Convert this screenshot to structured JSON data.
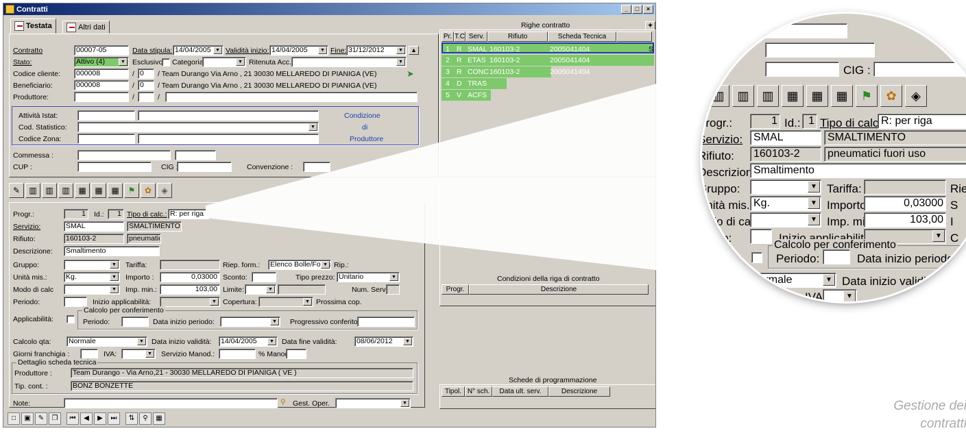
{
  "window": {
    "title": "Contratti",
    "min": "_",
    "max": "□",
    "close": "×"
  },
  "tabs": {
    "testata": "Testata",
    "altri": "Altri dati"
  },
  "header": {
    "contratto_lbl": "Contratto",
    "contratto": "00007-05",
    "data_stipula_lbl": "Data stipula:",
    "data_stipula": "14/04/2005",
    "validita_lbl": "Validità inizio:",
    "validita": "14/04/2005",
    "fine_lbl": "Fine:",
    "fine": "31/12/2012",
    "stato_lbl": "Stato:",
    "stato": "Attivo (4)",
    "esclusivo_lbl": "Esclusivo:",
    "categoria_lbl": "Categoria",
    "ritenuta_lbl": "Ritenuta Acc.:",
    "codcli_lbl": "Codice cliente:",
    "codcli": "000008",
    "codcli_n": "0",
    "codcli_desc": "/ Team Durango  Via Arno , 21  30030  MELLAREDO DI PIANIGA  (VE)",
    "benef_lbl": "Beneficiario:",
    "benef": "000008",
    "benef_n": "0",
    "benef_desc": "/ Team Durango  Via Arno , 21  30030  MELLAREDO DI PIANIGA  (VE)",
    "prod_lbl": "Produttore:",
    "slash1": "/",
    "slash2": "/",
    "istat_lbl": "Attività Istat:",
    "codstat_lbl": "Cod. Statistico:",
    "codzona_lbl": "Codice Zona:",
    "cond1": "Condizione",
    "cond2": "di",
    "cond3": "Produttore",
    "commessa_lbl": "Commessa :",
    "cup_lbl": "CUP :",
    "cig_lbl": "CIG :",
    "conv_lbl": "Convenzione :"
  },
  "righe": {
    "title": "Righe contratto",
    "cols": [
      "Pr.",
      "T.C.",
      "Serv.",
      "Rifiuto",
      "Scheda Tecnica"
    ],
    "rows": [
      {
        "pr": "1",
        "tc": "R",
        "serv": "SMAL",
        "rif": "160103-2",
        "sch": "2005041404",
        "x": "S"
      },
      {
        "pr": "2",
        "tc": "R",
        "serv": "ETAS",
        "rif": "160103-2",
        "sch": "2005041404",
        "x": ""
      },
      {
        "pr": "3",
        "tc": "R",
        "serv": "CONC",
        "rif": "160103-2",
        "sch": "2005041404",
        "x": ""
      },
      {
        "pr": "4",
        "tc": "D",
        "serv": "TRAS",
        "rif": "",
        "sch": "",
        "x": ""
      },
      {
        "pr": "5",
        "tc": "V",
        "serv": "ACFS",
        "rif": "",
        "sch": "",
        "x": ""
      }
    ]
  },
  "condizioni": {
    "title": "Condizioni della riga di contratto",
    "cols": [
      "Progr.",
      "Descrizione"
    ]
  },
  "schede": {
    "title": "Schede di programmazione",
    "cols": [
      "Tipol.",
      "N° sch.",
      "Data ult. serv.",
      "Descrizione"
    ]
  },
  "detail": {
    "progr_lbl": "Progr.:",
    "progr": "1",
    "id_lbl": "Id.:",
    "id": "1",
    "tipo_lbl": "Tipo di calc.:",
    "tipo": "R: per riga",
    "serv_lbl": "Servizio:",
    "serv": "SMAL",
    "serv_desc": "SMALTIMENTO",
    "rif_lbl": "Rifiuto:",
    "rif": "160103-2",
    "rif_desc": "pneumatici fuori uso",
    "descr_lbl": "Descrizione:",
    "descr": "Smaltimento",
    "gruppo_lbl": "Gruppo:",
    "tariffa_lbl": "Tariffa:",
    "riep_lbl": "Riep. form.:",
    "riep": "Elenco Bolle/Formu",
    "rip_lbl": "Rip.:",
    "um_lbl": "Unità mis.:",
    "um": "Kg.",
    "importo_lbl": "Importo :",
    "importo": "0,03000",
    "sconto_lbl": "Sconto:",
    "tipoprezzo_lbl": "Tipo prezzo:",
    "tipoprezzo": "Unitario",
    "modo_lbl": "Modo di calc",
    "impmin_lbl": "Imp. min.:",
    "impmin": "103,00",
    "limite_lbl": "Limite:",
    "numserv_lbl": "Num. Serv.:",
    "periodo_lbl": "Periodo:",
    "inizio_lbl": "Inizio applicabilità:",
    "copertura_lbl": "Copertura:",
    "prossima_lbl": "Prossima cop.",
    "applic_lbl": "Applicabilità:",
    "calcolo_grp": "Calcolo per conferimento",
    "periodo2_lbl": "Periodo:",
    "datainizio_lbl": "Data inizio periodo:",
    "progressivo_lbl": "Progressivo conferito:",
    "calcqta_lbl": "Calcolo qta:",
    "calcqta": "Normale",
    "datainiziov_lbl": "Data inizio validità:",
    "datainiziov": "14/04/2005",
    "datafine_lbl": "Data fine validità:",
    "datafine": "08/06/2012",
    "giorni_lbl": "Giorni franchigia :",
    "iva_lbl": "IVA:",
    "manod_lbl": "Servizio Manod.:",
    "pmanod_lbl": "% Manod.:",
    "dett_grp": "Dettaglio scheda tecnica",
    "produttore_lbl": "Produttore :",
    "produttore": "Team Durango - Via Arno,21 - 30030  MELLAREDO DI PIANIGA ( VE )",
    "tipcont_lbl": "Tip. cont. :",
    "tipcont": "BONZ BONZETTE",
    "note_lbl": "Note:",
    "gestoper_lbl": "Gest. Oper."
  },
  "lens": {
    "sv_lbl": "Servizio:",
    "rif_lbl": "Rifiuto:",
    "cig_lbl": "CIG :",
    "a_lbl": "a :",
    "riep": "Rie",
    "s": "S",
    "c": "C",
    "i": "I"
  },
  "caption": [
    "Gestione dei",
    "contratti"
  ]
}
